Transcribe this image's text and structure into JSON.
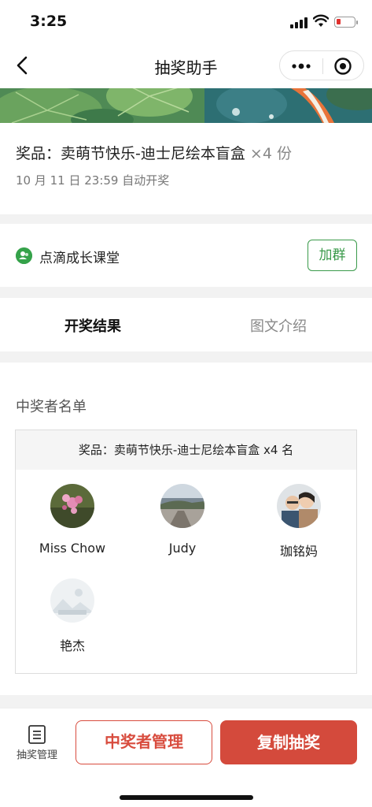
{
  "status_bar": {
    "time": "3:25",
    "battery_color": "#e0312e"
  },
  "nav": {
    "title": "抽奖助手",
    "icons": [
      "back-icon",
      "more-icon",
      "target-icon"
    ]
  },
  "prize": {
    "label": "奖品：卖萌节快乐-迪士尼绘本盲盒",
    "count": "×4 份",
    "draw_time": "10 月 11 日 23:59 自动开奖"
  },
  "group": {
    "name": "点滴成长课堂",
    "join_label": "加群",
    "accent": "#3a9a4a"
  },
  "tabs": [
    {
      "label": "开奖结果",
      "active": true
    },
    {
      "label": "图文介绍",
      "active": false
    }
  ],
  "winners": {
    "heading": "中奖者名单",
    "box_header": "奖品：卖萌节快乐-迪士尼绘本盲盒 x4 名",
    "list": [
      {
        "name": "Miss Chow"
      },
      {
        "name": "Judy"
      },
      {
        "name": "珈铭妈"
      },
      {
        "name": "艳杰"
      }
    ]
  },
  "bottom_bar": {
    "manage_label": "抽奖管理",
    "winner_manage_label": "中奖者管理",
    "copy_label": "复制抽奖",
    "accent": "#d44a3c"
  }
}
